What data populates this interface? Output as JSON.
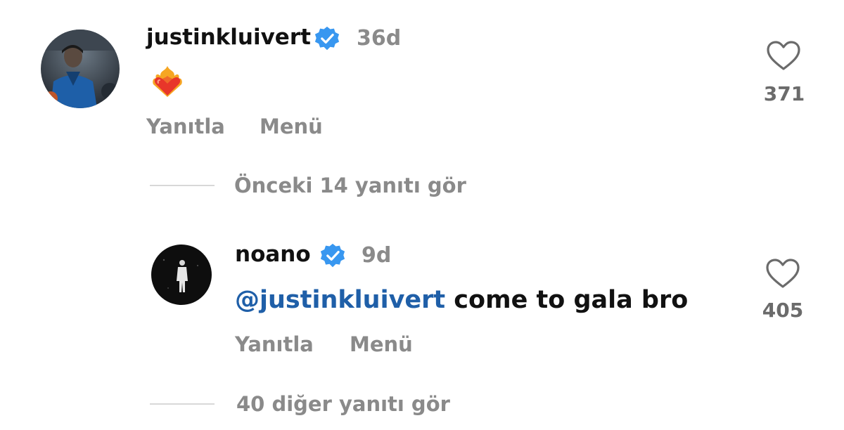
{
  "comments": [
    {
      "username": "justinkluivert",
      "verified": true,
      "time": "36d",
      "reaction_emoji": "heart-on-fire",
      "reply_label": "Yanıtla",
      "menu_label": "Menü",
      "likes": "371"
    },
    {
      "username": "noano",
      "verified": true,
      "time": "9d",
      "mention": "@justinkluivert",
      "text": " come to gala bro",
      "reply_label": "Yanıtla",
      "menu_label": "Menü",
      "likes": "405"
    }
  ],
  "view_previous_replies": "Önceki 14 yanıtı gör",
  "view_more_replies": "40 diğer yanıtı gör",
  "colors": {
    "verified": "#3897f0",
    "mention": "#1f5fa8",
    "muted": "#8a8a8a"
  }
}
